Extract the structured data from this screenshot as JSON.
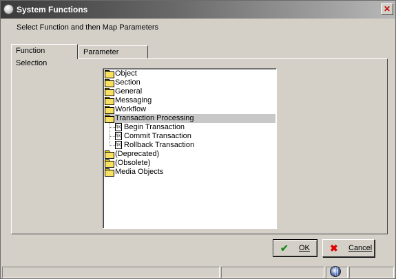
{
  "window": {
    "title": "System Functions"
  },
  "instruction": "Select Function and then Map Parameters",
  "tabs": [
    {
      "label": "Function Selection",
      "active": true
    },
    {
      "label": "Parameter Mapping",
      "active": false
    }
  ],
  "tree": {
    "items": [
      {
        "label": "Object",
        "icon": "folder-icon"
      },
      {
        "label": "Section",
        "icon": "folder-icon"
      },
      {
        "label": "General",
        "icon": "folder-icon"
      },
      {
        "label": "Messaging",
        "icon": "folder-icon"
      },
      {
        "label": "Workflow",
        "icon": "folder-icon"
      },
      {
        "label": "Transaction Processing",
        "icon": "open-folder-icon",
        "selected": true,
        "expanded": true
      },
      {
        "label": "Begin Transaction",
        "icon": "function-doc-icon",
        "child": true
      },
      {
        "label": "Commit Transaction",
        "icon": "function-doc-icon",
        "child": true
      },
      {
        "label": "Rollback Transaction",
        "icon": "function-doc-icon",
        "child": true
      },
      {
        "label": "(Deprecated)",
        "icon": "folder-icon"
      },
      {
        "label": "(Obsolete)",
        "icon": "folder-icon"
      },
      {
        "label": "Media Objects",
        "icon": "folder-icon"
      }
    ],
    "doc_icon_text": "f(x)"
  },
  "buttons": {
    "ok_label": "OK",
    "cancel_label": "Cancel"
  },
  "colors": {
    "selection": "#c8c8c8",
    "ok_check": "#1a8a1a",
    "cancel_cross": "#e00000"
  }
}
